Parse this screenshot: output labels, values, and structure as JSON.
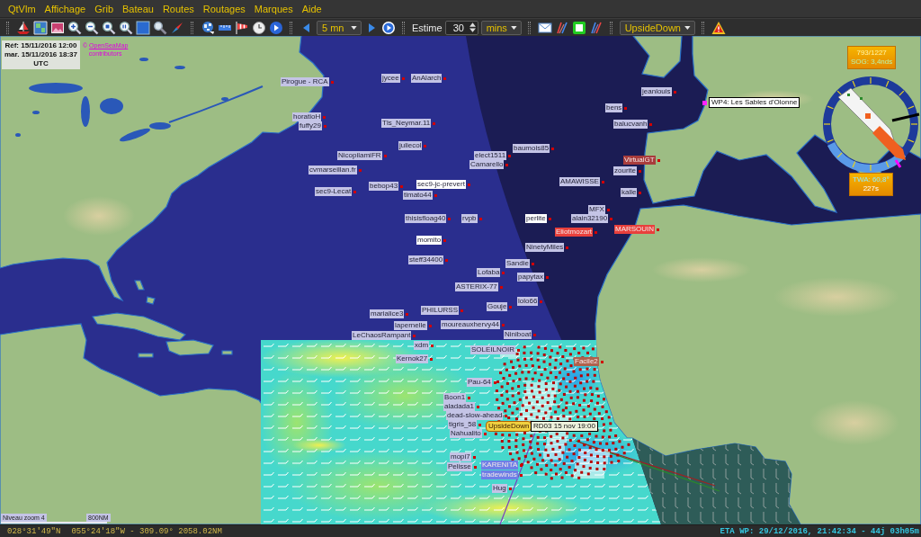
{
  "menu": [
    "QtVlm",
    "Affichage",
    "Grib",
    "Bateau",
    "Routes",
    "Routages",
    "Marques",
    "Aide"
  ],
  "toolbar": {
    "step": "5 mn",
    "estime_label": "Estime",
    "estime_value": "30",
    "estime_unit": "mins",
    "boat": "UpsideDown"
  },
  "map": {
    "reference": [
      "Réf: 15/11/2016 12:00",
      "mar. 15/11/2016 18:37",
      "UTC"
    ],
    "attribution": {
      "prefix": "©",
      "link": "OpenSeaMap",
      "suffix": "contributors"
    },
    "boats": [
      {
        "name": "Pirogue - RCA",
        "color": "#c4c4e6"
      },
      {
        "name": "jycee",
        "color": "#c4c4e6"
      },
      {
        "name": "AnAlarch",
        "color": "#c4c4e6"
      },
      {
        "name": "horatioH",
        "color": "#c4c4e6"
      },
      {
        "name": "fuffy29",
        "color": "#c4c4e6"
      },
      {
        "name": "Tls_Neymar.11",
        "color": "#c4c4e6"
      },
      {
        "name": "juliecol",
        "color": "#c4c4e6"
      },
      {
        "name": "NicopilamiFR",
        "color": "#c4c4e6"
      },
      {
        "name": "cvmarseillan.fr",
        "color": "#c4c4e6"
      },
      {
        "name": "bebop43",
        "color": "#c4c4e6"
      },
      {
        "name": "sec9-Lecat",
        "color": "#c4c4e6"
      },
      {
        "name": "sec9-jc-prevert",
        "color": "#ffffff"
      },
      {
        "name": "timato44",
        "color": "#c4c4e6"
      },
      {
        "name": "elect1511",
        "color": "#c4c4e6"
      },
      {
        "name": "Camarello",
        "color": "#c4c4e6"
      },
      {
        "name": "baumois85",
        "color": "#c4c4e6"
      },
      {
        "name": "AMAWISSE",
        "color": "#c4c4e6"
      },
      {
        "name": "thisisfloag40",
        "color": "#c4c4e6"
      },
      {
        "name": "rvpb",
        "color": "#c4c4e6"
      },
      {
        "name": "momito",
        "color": "#ffffff"
      },
      {
        "name": "steff34400",
        "color": "#c4c4e6"
      },
      {
        "name": "perlite",
        "color": "#ffffff"
      },
      {
        "name": "MFX",
        "color": "#c4c4e6"
      },
      {
        "name": "alain32190",
        "color": "#c4c4e6"
      },
      {
        "name": "Eliotmozart",
        "color": "#e8403c"
      },
      {
        "name": "MARSOUIN",
        "color": "#e8403c"
      },
      {
        "name": "NinetyMiles",
        "color": "#c4c4e6"
      },
      {
        "name": "Sandie",
        "color": "#c4c4e6"
      },
      {
        "name": "Lofaba",
        "color": "#c4c4e6"
      },
      {
        "name": "papytax",
        "color": "#c4c4e6"
      },
      {
        "name": "ASTERIX-77",
        "color": "#c4c4e6"
      },
      {
        "name": "marialice3",
        "color": "#c4c4e6"
      },
      {
        "name": "PHILURSS",
        "color": "#c4c4e6"
      },
      {
        "name": "Gouje",
        "color": "#c4c4e6"
      },
      {
        "name": "lolo66",
        "color": "#c4c4e6"
      },
      {
        "name": "lapernelle",
        "color": "#c4c4e6"
      },
      {
        "name": "moureauxhervy44",
        "color": "#c4c4e6"
      },
      {
        "name": "LeChaosRampant",
        "color": "#c4c4e6"
      },
      {
        "name": "Niniboat",
        "color": "#c4c4e6"
      },
      {
        "name": "xdm",
        "color": "#c4c4e6"
      },
      {
        "name": "SOLEILNOIR",
        "color": "#c4c4e6"
      },
      {
        "name": "Kernok27",
        "color": "#c4c4e6"
      },
      {
        "name": "Facile2",
        "color": "#b0604c"
      },
      {
        "name": "Pau-64",
        "color": "#c4c4e6"
      },
      {
        "name": "Boon1",
        "color": "#c4c4e6"
      },
      {
        "name": "aladada1",
        "color": "#c4c4e6"
      },
      {
        "name": "dead-slow-ahead",
        "color": "#c4c4e6"
      },
      {
        "name": "tigris_58",
        "color": "#c4c4e6"
      },
      {
        "name": "Nahualito",
        "color": "#c4c4e6"
      },
      {
        "name": "mopi7",
        "color": "#c4c4e6"
      },
      {
        "name": "Pelisse",
        "color": "#c4c4e6"
      },
      {
        "name": "KARENITA",
        "color": "#6e7ee6"
      },
      {
        "name": "tradewinds",
        "color": "#6e7ee6"
      },
      {
        "name": "Hug",
        "color": "#c4c4e6"
      },
      {
        "name": "jeanlouis",
        "color": "#c4c4e6"
      },
      {
        "name": "bens",
        "color": "#c4c4e6"
      },
      {
        "name": "balucvanh",
        "color": "#c4c4e6"
      },
      {
        "name": "VirtualGT",
        "color": "#a83c3c"
      },
      {
        "name": "zourite",
        "color": "#c4c4e6"
      },
      {
        "name": "kalle",
        "color": "#c4c4e6"
      }
    ],
    "own_boat": "UpsideDown",
    "route_point": "RD03 15 nov 19:00",
    "waypoint": "WP4: Les Sables d'Olonne",
    "boat_panel": [
      "793/1227",
      "SOG: 3,4nds"
    ],
    "wind_panel": [
      "TWA: 60,8°",
      "227s"
    ],
    "zoom_level": "Niveau zoom 4",
    "scale": "800NM"
  },
  "status_bar": {
    "latitude": "028°31'49\"N",
    "position": "055°24'18\"W - 309.09° 2058.02NM",
    "eta": "ETA WP: 29/12/2016, 21:42:34 - 44j 03h05m"
  }
}
